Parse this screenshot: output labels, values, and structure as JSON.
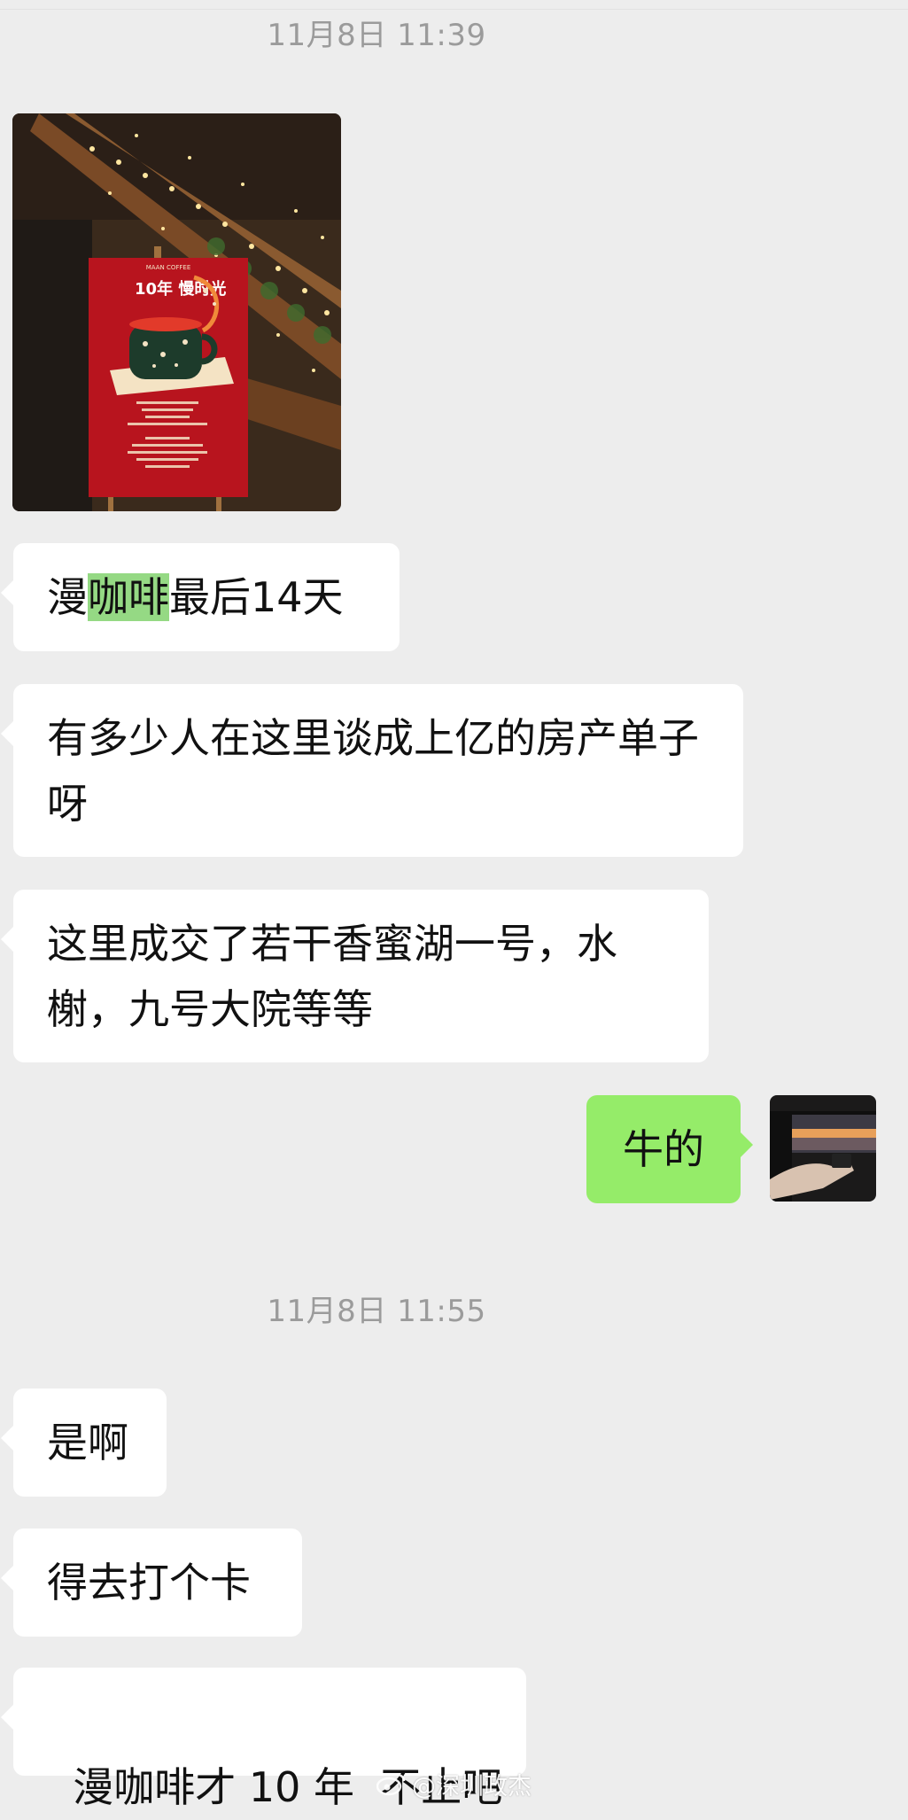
{
  "chat": {
    "timestamp_1": "11月8日 11:39",
    "timestamp_2": "11月8日 11:55",
    "msg_photo": {
      "poster_title": "10年 慢时光",
      "poster_brand": "MAAN COFFEE"
    },
    "msg_1": {
      "before": "漫",
      "highlight": "咖啡",
      "after": "最后14天"
    },
    "msg_2": "有多少人在这里谈成上亿的房产单子呀",
    "msg_3": "这里成交了若干香蜜湖一号，水榭，九号大院等等",
    "msg_self": "牛的",
    "msg_4": "是啊",
    "msg_5": "得去打个卡",
    "msg_6": "漫咖啡才 10 年  不止吧"
  },
  "watermark": {
    "text": "@深圳政杰"
  },
  "colors": {
    "background": "#ededed",
    "bubble_incoming": "#ffffff",
    "bubble_outgoing": "#95ec69",
    "highlight": "#95d984",
    "timestamp": "#9b9b9b"
  }
}
